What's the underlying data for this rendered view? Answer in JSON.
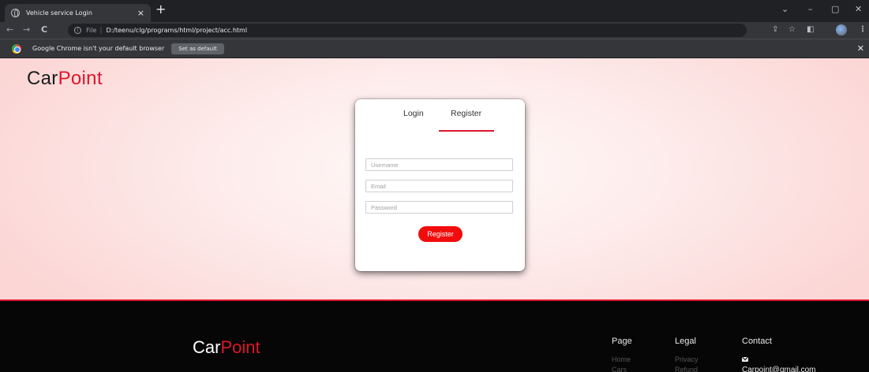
{
  "browser": {
    "tab_title": "Vehicle service Login",
    "tab_close": "×",
    "new_tab": "+",
    "window_controls": {
      "dropdown": "⌄",
      "minimize": "–",
      "maximize": "▢",
      "close": "✕"
    },
    "nav": {
      "back": "←",
      "forward": "→",
      "reload": "C"
    },
    "omnibox": {
      "scheme_label": "File",
      "separator": "|",
      "url": "D:/teenu/clg/programs/html/project/acc.html"
    },
    "toolbar_icons": {
      "share": "⇪",
      "bookmark": "☆",
      "side_panel": "◧",
      "menu": "⋮"
    },
    "infobar": {
      "message": "Google Chrome isn't your default browser",
      "button_label": "Set as default",
      "close": "✕"
    }
  },
  "page": {
    "brand": {
      "part1": "Car",
      "part2": "Point",
      "accent_color": "#e0142a"
    },
    "auth_card": {
      "tabs": [
        {
          "label": "Login",
          "active": false
        },
        {
          "label": "Register",
          "active": true
        }
      ],
      "fields": {
        "username_placeholder": "Username",
        "email_placeholder": "Email",
        "password_placeholder": "Password"
      },
      "submit_label": "Register",
      "submit_color": "#f10d0d"
    },
    "footer": {
      "brand": {
        "part1": "Car",
        "part2": "Point"
      },
      "columns": [
        {
          "heading": "Page",
          "links": [
            "Home",
            "Cars"
          ]
        },
        {
          "heading": "Legal",
          "links": [
            "Privacy",
            "Refund"
          ]
        },
        {
          "heading": "Contact",
          "email": "Carpoint@gmail.com"
        }
      ]
    }
  }
}
